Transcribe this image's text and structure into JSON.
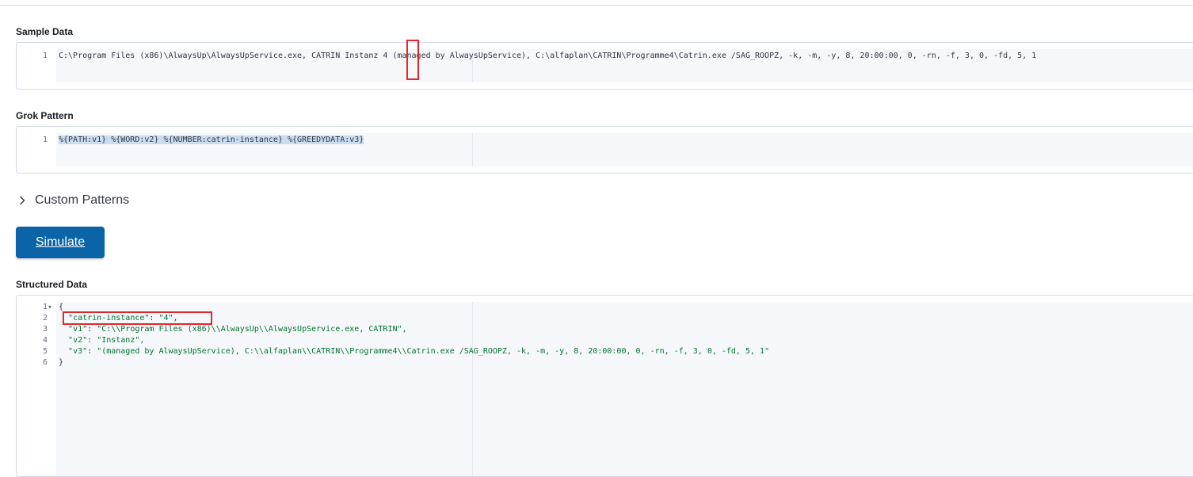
{
  "sample_data": {
    "label": "Sample Data",
    "lines": [
      {
        "number": "1",
        "before": "C:\\Program Files (x86)\\AlwaysUp\\AlwaysUpService.exe, CATRIN Instanz ",
        "highlight": "4",
        "after": " (managed by AlwaysUpService), C:\\alfaplan\\CATRIN\\Programme4\\Catrin.exe /SAG_ROOPZ, -k, -m, -y, 8, 20:00:00, 0, -rn, -f, 3, 0, -fd, 5, 1"
      }
    ]
  },
  "grok_pattern": {
    "label": "Grok Pattern",
    "lines": [
      {
        "number": "1",
        "text": "%{PATH:v1} %{WORD:v2} %{NUMBER:catrin-instance} %{GREEDYDATA:v3}"
      }
    ]
  },
  "custom_patterns": {
    "label": "Custom Patterns",
    "icon": "chevron-right-icon"
  },
  "simulate_button": {
    "label": "Simulate",
    "color": "#0b64a8"
  },
  "structured_data": {
    "label": "Structured Data",
    "line_numbers": [
      "1",
      "2",
      "3",
      "4",
      "5",
      "6"
    ],
    "fold_icon": "fold-arrow-icon",
    "lines": [
      {
        "key": "",
        "value": "{"
      },
      {
        "key": "\"catrin-instance\"",
        "value": "\"4\","
      },
      {
        "key": "\"v1\"",
        "value": "\"C:\\\\Program Files (x86)\\\\AlwaysUp\\\\AlwaysUpService.exe, CATRIN\","
      },
      {
        "key": "\"v2\"",
        "value": "\"Instanz\","
      },
      {
        "key": "\"v3\"",
        "value": "\"(managed by AlwaysUpService), C:\\\\alfaplan\\\\CATRIN\\\\Programme4\\\\Catrin.exe /SAG_ROOPZ, -k, -m, -y, 8, 20:00:00, 0, -rn, -f, 3, 0, -fd, 5, 1\""
      },
      {
        "key": "",
        "value": "}"
      }
    ]
  },
  "colors": {
    "annotation_red": "#e0272b",
    "selection": "#c9dcf0",
    "string_green": "#00752e"
  }
}
